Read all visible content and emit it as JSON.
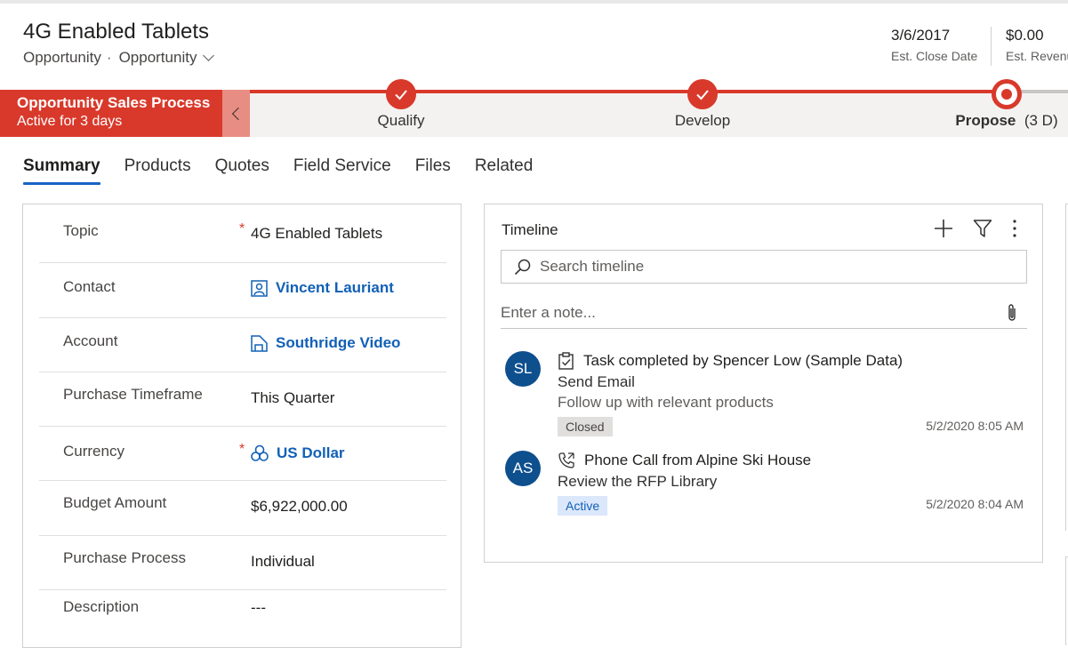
{
  "header": {
    "title": "4G Enabled Tablets",
    "entity": "Opportunity",
    "separator": "·",
    "form_name": "Opportunity",
    "fields": [
      {
        "value": "3/6/2017",
        "label": "Est. Close Date"
      },
      {
        "value": "$0.00",
        "label": "Est. Revenue"
      }
    ]
  },
  "bpf": {
    "process_name": "Opportunity Sales Process",
    "active_for": "Active for 3 days",
    "stages": [
      {
        "name": "Qualify",
        "status": "completed"
      },
      {
        "name": "Develop",
        "status": "completed"
      },
      {
        "name": "Propose",
        "duration": "(3 D)",
        "status": "active"
      }
    ],
    "accent_color": "#d8392b"
  },
  "tabs": [
    "Summary",
    "Products",
    "Quotes",
    "Field Service",
    "Files",
    "Related"
  ],
  "active_tab": "Summary",
  "form": {
    "fields": [
      {
        "label": "Topic",
        "required": "*",
        "value": "4G Enabled Tablets"
      },
      {
        "label": "Contact",
        "value": "Vincent Lauriant",
        "icon": "contact-icon"
      },
      {
        "label": "Account",
        "value": "Southridge Video",
        "icon": "account-icon"
      },
      {
        "label": "Purchase Timeframe",
        "value": "This Quarter"
      },
      {
        "label": "Currency",
        "required": "*",
        "value": "US Dollar",
        "icon": "currency-icon"
      },
      {
        "label": "Budget Amount",
        "value": "$6,922,000.00"
      },
      {
        "label": "Purchase Process",
        "value": "Individual"
      },
      {
        "label": "Description",
        "value": "---"
      }
    ]
  },
  "timeline": {
    "title": "Timeline",
    "search_placeholder": "Search timeline",
    "note_placeholder": "Enter a note...",
    "items": [
      {
        "initials": "SL",
        "icon": "task-icon",
        "title": "Task completed by Spencer Low (Sample Data)",
        "line1": "Send Email",
        "line2": "Follow up with relevant products",
        "status": "Closed",
        "time": "5/2/2020 8:05 AM"
      },
      {
        "initials": "AS",
        "icon": "phone-call-icon",
        "title": "Phone Call from Alpine Ski House",
        "line1": "Review the RFP Library",
        "status": "Active",
        "time": "5/2/2020 8:04 AM"
      }
    ]
  }
}
